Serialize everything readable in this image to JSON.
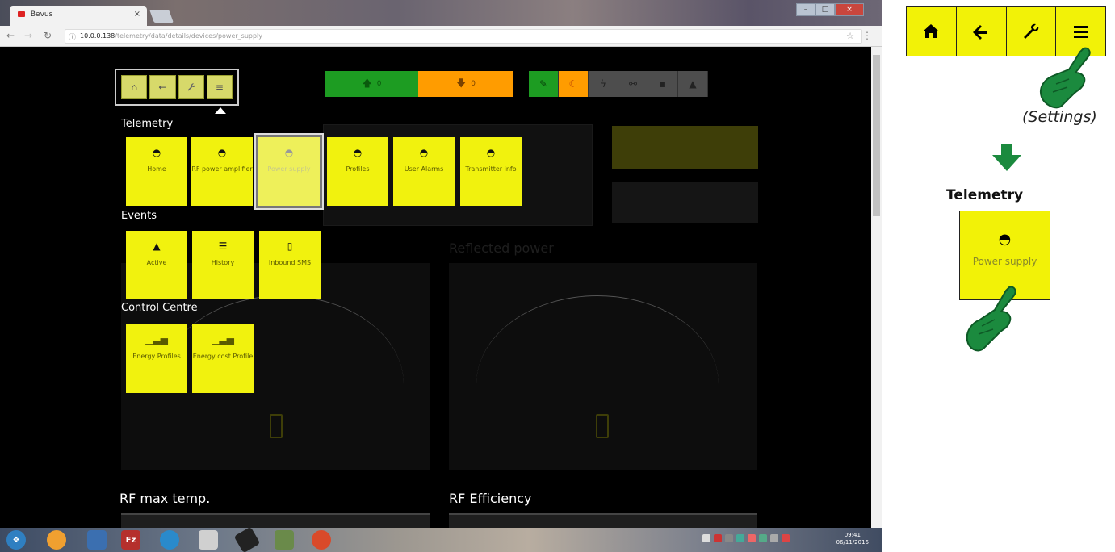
{
  "browser": {
    "tab_title": "Bevus",
    "tab_close": "×",
    "url_host": "10.0.0.138",
    "url_path": "/telemetry/data/details/devices/power_supply",
    "window_controls": [
      "–",
      "□",
      "×"
    ]
  },
  "app": {
    "mini_menu_icons": [
      "home-icon",
      "back-arrow-icon",
      "wrench-icon",
      "menu-icon"
    ],
    "cmd_up_value": "0",
    "cmd_down_value": "0",
    "status_icons": [
      "plug-icon",
      "moon-icon",
      "lightning-icon",
      "link-icon",
      "lock-icon",
      "warning-icon"
    ],
    "sections": {
      "telemetry": "Telemetry",
      "events": "Events",
      "control": "Control Centre"
    },
    "telemetry_tiles": [
      {
        "label": "Home",
        "icon": "gauge-icon"
      },
      {
        "label": "RF power amplifier",
        "icon": "gauge-icon"
      },
      {
        "label": "Power supply",
        "icon": "gauge-icon",
        "selected": true
      },
      {
        "label": "Profiles",
        "icon": "gauge-icon"
      },
      {
        "label": "User Alarms",
        "icon": "gauge-icon"
      },
      {
        "label": "Transmitter info",
        "icon": "gauge-icon"
      }
    ],
    "event_tiles": [
      {
        "label": "Active",
        "icon": "warning-icon"
      },
      {
        "label": "History",
        "icon": "list-icon"
      },
      {
        "label": "Inbound SMS",
        "icon": "phone-icon"
      }
    ],
    "control_tiles": [
      {
        "label": "Energy Profiles",
        "icon": "bar-chart-icon"
      },
      {
        "label": "Energy cost Profile",
        "icon": "bar-chart-icon"
      }
    ],
    "background": {
      "reflected_power": "Reflected power",
      "rf_max_temp": "RF max temp.",
      "rf_efficiency": "RF Efficiency"
    }
  },
  "annotation": {
    "toolbar_icons": [
      "home-icon",
      "back-arrow-icon",
      "wrench-icon",
      "menu-icon"
    ],
    "caption": "(Settings)",
    "section_title": "Telemetry",
    "tile_label": "Power supply",
    "accent_color": "#f2f207",
    "hand_color": "#1b8a3e"
  },
  "taskbar": {
    "clock_time": "09:41",
    "clock_date": "06/11/2016"
  }
}
